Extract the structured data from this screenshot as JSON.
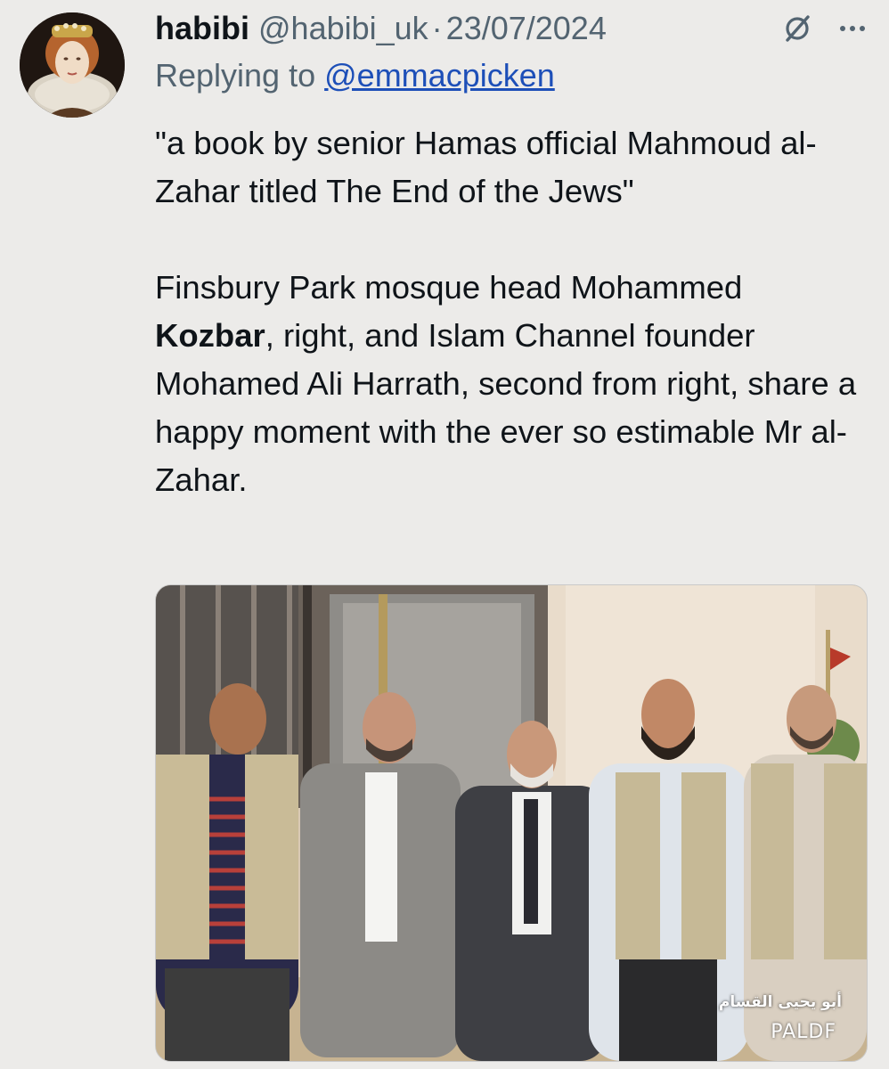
{
  "tweet": {
    "author": {
      "display_name": "habibi",
      "handle": "@habibi_uk",
      "avatar_icon": "avatar-portrait"
    },
    "separator": "·",
    "date": "23/07/2024",
    "header_icons": [
      "grok-icon",
      "more-icon"
    ],
    "reply": {
      "prefix": "Replying to",
      "mention": "@emmacpicken"
    },
    "body": {
      "paragraph_1": "\"a book by senior Hamas official Mahmoud al-Zahar titled The End of the Jews\"",
      "paragraph_2_prefix": "Finsbury Park mosque head Mohammed",
      "paragraph_2_bold": "Kozbar",
      "paragraph_2_suffix": ", right, and Islam Channel founder Mohamed Ali Harrath, second from right, share a happy moment with the ever so estimable Mr al-Zahar."
    },
    "media": {
      "watermark_arabic": "أبو يحيى القسام",
      "watermark": "PALDF"
    }
  },
  "colors": {
    "background": "#ecebe9",
    "text": "#0f1419",
    "muted": "#536471",
    "link": "#1d4fb8"
  }
}
